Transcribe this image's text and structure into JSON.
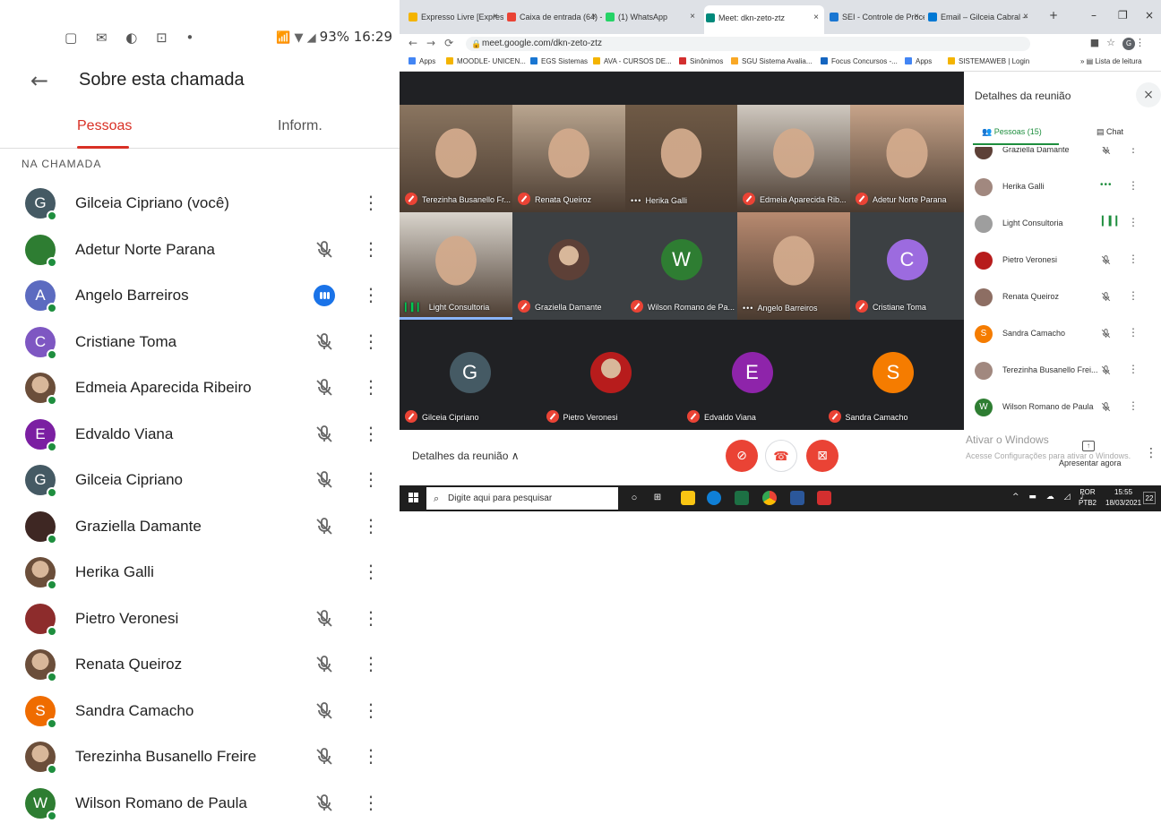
{
  "phone": {
    "status_icons_left": "▢ ✉ ◐ ⊡ •",
    "status_right": "93% 16:29",
    "title": "Sobre esta chamada",
    "tabs": [
      "Pessoas",
      "Inform."
    ],
    "section": "NA CHAMADA",
    "participants": [
      {
        "name": "Gilceia Cipriano (você)",
        "initial": "G",
        "color": "#455a64",
        "mic": "none"
      },
      {
        "name": "Adetur Norte Parana",
        "initial": "",
        "color": "#2e7d32",
        "mic": "muted"
      },
      {
        "name": "Angelo Barreiros",
        "initial": "A",
        "color": "#5c6bc0",
        "mic": "speaking"
      },
      {
        "name": "Cristiane Toma",
        "initial": "C",
        "color": "#7e57c2",
        "mic": "muted"
      },
      {
        "name": "Edmeia Aparecida Ribeiro",
        "initial": "",
        "color": "photo",
        "mic": "muted"
      },
      {
        "name": "Edvaldo Viana",
        "initial": "E",
        "color": "#7b1fa2",
        "mic": "muted"
      },
      {
        "name": "Gilceia Cipriano",
        "initial": "G",
        "color": "#455a64",
        "mic": "muted"
      },
      {
        "name": "Graziella Damante",
        "initial": "",
        "color": "#3e2723",
        "mic": "muted"
      },
      {
        "name": "Herika Galli",
        "initial": "",
        "color": "photo",
        "mic": "none"
      },
      {
        "name": "Pietro Veronesi",
        "initial": "",
        "color": "#8d2c2c",
        "mic": "muted"
      },
      {
        "name": "Renata Queiroz",
        "initial": "",
        "color": "photo",
        "mic": "muted"
      },
      {
        "name": "Sandra Camacho",
        "initial": "S",
        "color": "#ef6c00",
        "mic": "muted"
      },
      {
        "name": "Terezinha Busanello Freire",
        "initial": "",
        "color": "photo",
        "mic": "muted"
      },
      {
        "name": "Wilson Romano de Paula",
        "initial": "W",
        "color": "#2e7d32",
        "mic": "muted"
      }
    ]
  },
  "browser": {
    "tabs": [
      {
        "label": "Expresso Livre [Expresso",
        "color": "#f4b400"
      },
      {
        "label": "Caixa de entrada (64) -",
        "color": "#ea4335"
      },
      {
        "label": "(1) WhatsApp",
        "color": "#25d366"
      },
      {
        "label": "Meet: dkn-zeto-ztz",
        "color": "#00897b"
      },
      {
        "label": "SEI - Controle de Proce",
        "color": "#1976d2"
      },
      {
        "label": "Email – Gilceia Cabral –",
        "color": "#0078d4"
      }
    ],
    "url": "meet.google.com/dkn-zeto-ztz",
    "profile_initial": "G",
    "bookmarks": [
      "Apps",
      "MOODLE- UNICEN...",
      "EGS Sistemas",
      "AVA - CURSOS DE...",
      "Sinônimos",
      "SGU Sistema Avalia...",
      "Focus Concursos -...",
      "Apps",
      "SISTEMAWEB | Login"
    ],
    "reading_list": "Lista de leitura"
  },
  "meet": {
    "tiles": [
      {
        "name": "Terezinha Busanello Fr...",
        "kind": "video",
        "bg": "#8a7560",
        "mic": "muted"
      },
      {
        "name": "Renata Queiroz",
        "kind": "video",
        "bg": "#b9a58f",
        "mic": "muted"
      },
      {
        "name": "Herika Galli",
        "kind": "video",
        "bg": "#6f5a46",
        "mic": "dots"
      },
      {
        "name": "Edmeia Aparecida Rib...",
        "kind": "video",
        "bg": "#cfc8bf",
        "mic": "muted"
      },
      {
        "name": "Adetur Norte Parana",
        "kind": "video",
        "bg": "#c7a48a",
        "mic": "muted"
      },
      {
        "name": "Light Consultoria",
        "kind": "video",
        "bg": "#d9d4cc",
        "mic": "level",
        "active": true
      },
      {
        "name": "Graziella Damante",
        "kind": "mini",
        "bg": "#3c4043",
        "mic": "muted",
        "avatar": "#5d4037"
      },
      {
        "name": "Wilson Romano de Pa...",
        "kind": "initial",
        "bg": "#3c4043",
        "mic": "muted",
        "initial": "W",
        "avatar": "#2e7d32"
      },
      {
        "name": "Angelo Barreiros",
        "kind": "video",
        "bg": "#b88a70",
        "mic": "dots"
      },
      {
        "name": "Cristiane Toma",
        "kind": "initial",
        "bg": "#3c4043",
        "mic": "muted",
        "initial": "C",
        "avatar": "#9c6bdf"
      },
      {
        "name": "Gilceia Cipriano",
        "kind": "initial",
        "bg": "#202124",
        "mic": "muted",
        "initial": "G",
        "avatar": "#455a64"
      },
      {
        "name": "Pietro Veronesi",
        "kind": "mini",
        "bg": "#202124",
        "mic": "muted",
        "avatar": "#b71c1c"
      },
      {
        "name": "Edvaldo Viana",
        "kind": "initial",
        "bg": "#202124",
        "mic": "muted",
        "initial": "E",
        "avatar": "#8e24aa"
      },
      {
        "name": "Sandra Camacho",
        "kind": "initial",
        "bg": "#202124",
        "mic": "muted",
        "initial": "S",
        "avatar": "#f57c00"
      }
    ],
    "details_label": "Detalhes da reunião",
    "side_title": "Detalhes da reunião",
    "side_tab_people": "Pessoas (15)",
    "side_tab_chat": "Chat",
    "side_people": [
      {
        "name": "Graziella Damante",
        "color": "#5d4037",
        "initial": "",
        "mic": "muted"
      },
      {
        "name": "Herika Galli",
        "color": "#a1887f",
        "initial": "",
        "mic": "dots"
      },
      {
        "name": "Light Consultoria",
        "color": "#9e9e9e",
        "initial": "",
        "mic": "level"
      },
      {
        "name": "Pietro Veronesi",
        "color": "#b71c1c",
        "initial": "",
        "mic": "muted"
      },
      {
        "name": "Renata Queiroz",
        "color": "#8d6e63",
        "initial": "",
        "mic": "muted"
      },
      {
        "name": "Sandra Camacho",
        "color": "#f57c00",
        "initial": "S",
        "mic": "muted"
      },
      {
        "name": "Terezinha Busanello Frei...",
        "color": "#a1887f",
        "initial": "",
        "mic": "muted"
      },
      {
        "name": "Wilson Romano de Paula",
        "color": "#2e7d32",
        "initial": "W",
        "mic": "muted"
      }
    ],
    "activate_title": "Ativar o Windows",
    "activate_sub": "Acesse Configurações para ativar o Windows.",
    "present_label": "Apresentar agora"
  },
  "taskbar": {
    "search_placeholder": "Digite aqui para pesquisar",
    "lang": "POR\nPTB2",
    "lang_top": "POR",
    "lang_bottom": "PTB2",
    "time": "15:55",
    "date": "18/03/2021",
    "notif": "22"
  }
}
